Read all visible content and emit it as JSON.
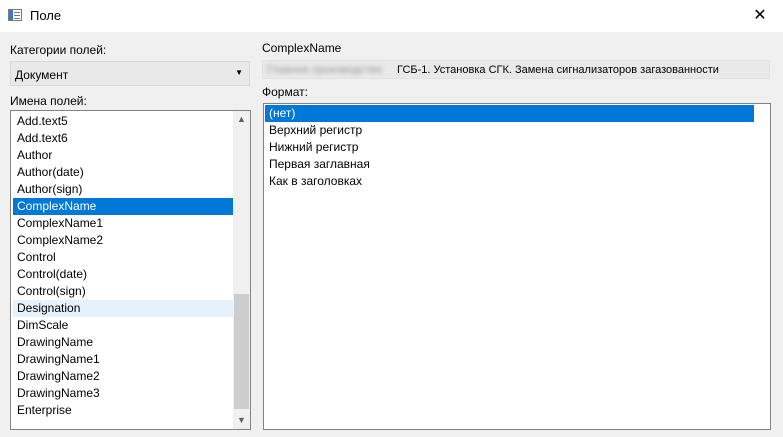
{
  "window": {
    "title": "Поле",
    "close_glyph": "✕"
  },
  "categories": {
    "label": "Категории полей:",
    "selected": "Документ"
  },
  "fields": {
    "label": "Имена полей:",
    "items": [
      "Add.text5",
      "Add.text6",
      "Author",
      "Author(date)",
      "Author(sign)",
      "ComplexName",
      "ComplexName1",
      "ComplexName2",
      "Control",
      "Control(date)",
      "Control(sign)",
      "Designation",
      "DimScale",
      "DrawingName",
      "DrawingName1",
      "DrawingName2",
      "DrawingName3",
      "Enterprise"
    ],
    "selected_index": 5,
    "hover_index": 11
  },
  "field_value": {
    "label": "ComplexName",
    "redacted": "Главное производство ",
    "text": "ГСБ-1. Установка СГК.  Замена сигнализаторов загазованности"
  },
  "format": {
    "label": "Формат:",
    "items": [
      "(нет)",
      "Верхний регистр",
      "Нижний регистр",
      "Первая заглавная",
      "Как в заголовках"
    ],
    "selected_index": 0
  },
  "icons": {
    "app": "window-app-icon",
    "close": "close-icon",
    "combo_arrow": "chevron-down-icon",
    "scroll_up": "scroll-up-icon",
    "scroll_down": "scroll-down-icon"
  },
  "colors": {
    "selection": "#0078d7",
    "hover": "#e5f1fb",
    "background": "#f0f0f0"
  }
}
